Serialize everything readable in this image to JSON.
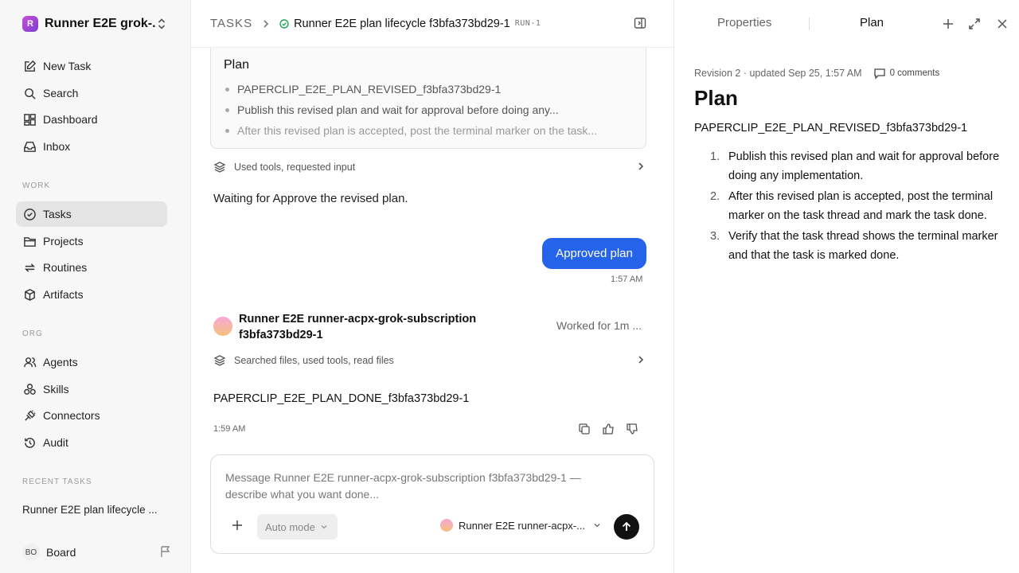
{
  "workspace": {
    "logo_letter": "R",
    "name": "Runner E2E grok-..."
  },
  "nav": {
    "top": [
      {
        "label": "New Task",
        "icon": "edit-icon"
      },
      {
        "label": "Search",
        "icon": "search-icon"
      },
      {
        "label": "Dashboard",
        "icon": "dashboard-icon"
      },
      {
        "label": "Inbox",
        "icon": "inbox-icon"
      }
    ],
    "work_label": "WORK",
    "work": [
      {
        "label": "Tasks",
        "icon": "check-circle-icon",
        "active": true
      },
      {
        "label": "Projects",
        "icon": "folder-icon"
      },
      {
        "label": "Routines",
        "icon": "repeat-icon"
      },
      {
        "label": "Artifacts",
        "icon": "box-icon"
      }
    ],
    "org_label": "ORG",
    "org": [
      {
        "label": "Agents",
        "icon": "users-icon"
      },
      {
        "label": "Skills",
        "icon": "skills-icon"
      },
      {
        "label": "Connectors",
        "icon": "plug-icon"
      },
      {
        "label": "Audit",
        "icon": "history-icon"
      }
    ],
    "recent_label": "RECENT TASKS",
    "recent": [
      {
        "label": "Runner E2E plan lifecycle ..."
      }
    ],
    "board": {
      "initials": "BO",
      "label": "Board"
    }
  },
  "header": {
    "root": "TASKS",
    "title": "Runner E2E plan lifecycle f3bfa373bd29-1",
    "run_id": "RUN-1"
  },
  "thread": {
    "plan_card": {
      "title": "Plan",
      "items": [
        "PAPERCLIP_E2E_PLAN_REVISED_f3bfa373bd29-1",
        "Publish this revised plan and wait for approval before doing any...",
        "After this revised plan is accepted, post the terminal marker on the task..."
      ]
    },
    "tools_1": "Used tools, requested input",
    "waiting": "Waiting for Approve the revised plan.",
    "user_msg": "Approved plan",
    "user_time": "1:57 AM",
    "agent_name": "Runner E2E runner-acpx-grok-subscription f3bfa373bd29-1",
    "worked": "Worked for 1m ...",
    "tools_2": "Searched files, used tools, read files",
    "done": "PAPERCLIP_E2E_PLAN_DONE_f3bfa373bd29-1",
    "done_time": "1:59 AM"
  },
  "composer": {
    "placeholder": "Message Runner E2E runner-acpx-grok-subscription f3bfa373bd29-1 — describe what you want done...",
    "mode": "Auto mode",
    "agent": "Runner E2E runner-acpx-..."
  },
  "panel": {
    "tabs": [
      "Properties",
      "Plan"
    ],
    "revision": "Revision 2 · updated Sep 25, 1:57 AM",
    "comments": "0 comments",
    "title": "Plan",
    "marker": "PAPERCLIP_E2E_PLAN_REVISED_f3bfa373bd29-1",
    "steps": [
      {
        "n": "1.",
        "text": "Publish this revised plan and wait for approval before doing any implementation."
      },
      {
        "n": "2.",
        "text": "After this revised plan is accepted, post the terminal marker on the task thread and mark the task done."
      },
      {
        "n": "3.",
        "text": "Verify that the task thread shows the terminal marker and that the task is marked done."
      }
    ]
  },
  "colors": {
    "accent": "#2563eb",
    "status_green": "#22a35a",
    "send_bg": "#111111"
  }
}
